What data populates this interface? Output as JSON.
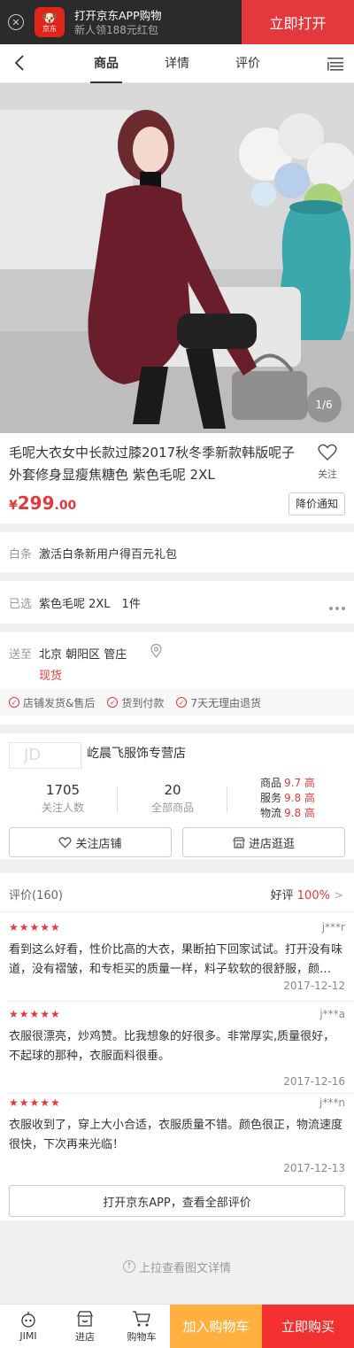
{
  "banner": {
    "title": "打开京东APP购物",
    "subtitle": "新人领188元红包",
    "logo_text": "京东",
    "open_label": "立即打开"
  },
  "nav": {
    "tabs": [
      "商品",
      "详情",
      "评价"
    ]
  },
  "hero": {
    "counter": "1/6"
  },
  "product": {
    "title": "毛呢大衣女中长款过膝2017秋冬季新款韩版呢子外套修身显瘦焦糖色 紫色毛呢 2XL",
    "fav_label": "关注",
    "price_symbol": "¥",
    "price_int": "299",
    "price_dec": ".00",
    "notify_label": "降价通知"
  },
  "promo": {
    "label": "白条",
    "text": "激活白条新用户得百元礼包"
  },
  "selected": {
    "label": "已选",
    "text": "紫色毛呢 2XL　1件"
  },
  "delivery": {
    "label": "送至",
    "address": "北京  朝阳区  管庄",
    "stock": "现货",
    "services": [
      "店铺发货&售后",
      "货到付款",
      "7天无理由退货"
    ]
  },
  "shop": {
    "logo_text": "JD",
    "name": "屹晨飞服饰专营店",
    "followers": "1705",
    "followers_label": "关注人数",
    "products": "20",
    "products_label": "全部商品",
    "scores": [
      {
        "k": "商品",
        "v": "9.7 高"
      },
      {
        "k": "服务",
        "v": "9.8 高"
      },
      {
        "k": "物流",
        "v": "9.8 高"
      }
    ],
    "follow_label": "关注店铺",
    "enter_label": "进店逛逛"
  },
  "reviews": {
    "count_label": "评价(160)",
    "good_label": "好评",
    "good_pct": "100%",
    "items": [
      {
        "stars": "★★★★★",
        "user": "j***r",
        "text": "看到这么好看，性价比高的大衣，果断拍下回家试试。打开没有味道，没有褶皱，和专柜买的质量一样，料子软软的很舒服，颜…",
        "date": "2017-12-12"
      },
      {
        "stars": "★★★★★",
        "user": "j***a",
        "text": "衣服很漂亮，炒鸡赞。比我想象的好很多。非常厚实,质量很好，不起球的那种，衣服面料很垂。",
        "date": "2017-12-16"
      },
      {
        "stars": "★★★★★",
        "user": "j***n",
        "text": "衣服收到了，穿上大小合适，衣服质量不错。颜色很正，物流速度很快，下次再来光临！",
        "date": "2017-12-13"
      }
    ],
    "all_label": "打开京东APP，查看全部评价"
  },
  "pullup": {
    "text": "上拉查看图文详情"
  },
  "bottom": {
    "jimi": "JIMI",
    "shop": "进店",
    "cart": "购物车",
    "add_cart": "加入购物车",
    "buy_now": "立即购买"
  },
  "colors": {
    "accent": "#e4393c",
    "cart_button": "#ffb03f",
    "buy_button": "#f23030"
  }
}
